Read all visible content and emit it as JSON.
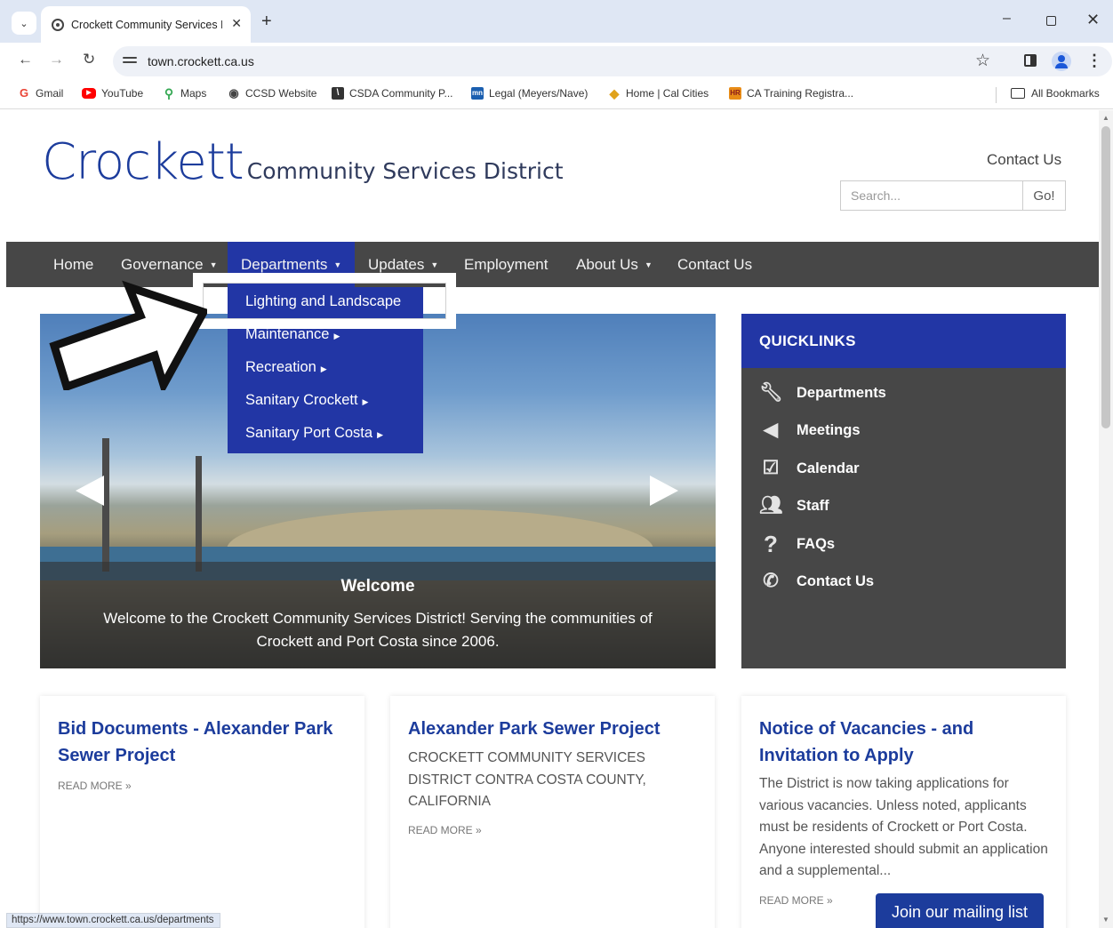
{
  "browser": {
    "tab_title": "Crockett Community Services D",
    "tab_close": "✕",
    "new_tab": "+",
    "url": "town.crockett.ca.us",
    "window_min": "–",
    "window_close": "✕",
    "bookmarks": [
      {
        "label": "Gmail",
        "icon": "gmail-icon",
        "color": "#ea4335"
      },
      {
        "label": "YouTube",
        "icon": "youtube-icon",
        "color": "#ff0000"
      },
      {
        "label": "Maps",
        "icon": "maps-pin-icon",
        "color": "#34a853"
      },
      {
        "label": "CCSD Website",
        "icon": "globe-icon",
        "color": "#444444"
      },
      {
        "label": "CSDA Community P...",
        "icon": "csda-icon",
        "color": "#333333"
      },
      {
        "label": "Legal (Meyers/Nave)",
        "icon": "mn-icon",
        "color": "#1b5fb0"
      },
      {
        "label": "Home | Cal Cities",
        "icon": "cal-cities-icon",
        "color": "#e0a21b"
      },
      {
        "label": "CA Training Registra...",
        "icon": "hr-icon",
        "color": "#e88c17"
      }
    ],
    "all_bookmarks": "All Bookmarks",
    "status_url": "https://www.town.crockett.ca.us/departments"
  },
  "site": {
    "logo_main": "Crockett",
    "logo_sub": "Community Services District",
    "header_contact": "Contact Us",
    "search_placeholder": "Search...",
    "search_button": "Go!",
    "brand_color": "#2236a5",
    "nav_bg": "#474747",
    "nav": [
      {
        "label": "Home",
        "dropdown": false
      },
      {
        "label": "Governance",
        "dropdown": true
      },
      {
        "label": "Departments",
        "dropdown": true,
        "active": true
      },
      {
        "label": "Updates",
        "dropdown": true
      },
      {
        "label": "Employment",
        "dropdown": false
      },
      {
        "label": "About Us",
        "dropdown": true
      },
      {
        "label": "Contact Us",
        "dropdown": false
      }
    ],
    "departments_menu": [
      {
        "label": "Lighting and Landscape",
        "submenu": false
      },
      {
        "label": "Maintenance",
        "submenu": true
      },
      {
        "label": "Recreation",
        "submenu": true
      },
      {
        "label": "Sanitary Crockett",
        "submenu": true
      },
      {
        "label": "Sanitary Port Costa",
        "submenu": true
      }
    ],
    "slider": {
      "title": "Welcome",
      "text": "Welcome to the Crockett Community Services District! Serving the communities of Crockett and Port Costa since 2006."
    },
    "quicklinks": {
      "title": "QUICKLINKS",
      "items": [
        {
          "label": "Departments",
          "icon": "wrench-icon"
        },
        {
          "label": "Meetings",
          "icon": "megaphone-icon"
        },
        {
          "label": "Calendar",
          "icon": "calendar-icon"
        },
        {
          "label": "Staff",
          "icon": "people-icon"
        },
        {
          "label": "FAQs",
          "icon": "question-icon"
        },
        {
          "label": "Contact Us",
          "icon": "phone-icon"
        }
      ]
    },
    "cards": [
      {
        "title": "Bid Documents - Alexander Park Sewer Project",
        "body": "",
        "more": "READ MORE »"
      },
      {
        "title": "Alexander Park Sewer Project",
        "body": "CROCKETT COMMUNITY SERVICES DISTRICT CONTRA COSTA COUNTY, CALIFORNIA",
        "more": "READ MORE »"
      },
      {
        "title": "Notice of Vacancies - and Invitation to Apply",
        "body": "The District is now taking applications for various vacancies. Unless noted, applicants must be residents of Crockett or Port Costa. Anyone interested should submit an application and a supplemental...",
        "more": "READ MORE »"
      }
    ],
    "mailing_list": "Join our mailing list"
  }
}
